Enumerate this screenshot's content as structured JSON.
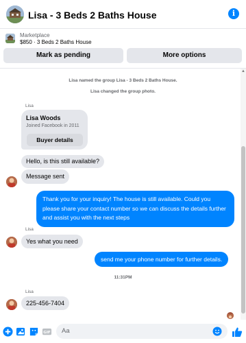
{
  "header": {
    "title": "Lisa - 3 Beds 2 Baths House",
    "info_icon": "info-icon",
    "accent": "#0084ff"
  },
  "marketplace": {
    "label": "Marketplace",
    "listing": "$850 · 3 Beds 2 Baths House",
    "pending_button": "Mark as pending",
    "more_button": "More options"
  },
  "chat": {
    "system_messages": [
      "Lisa named the group Lisa - 3 Beds 2 Baths House.",
      "Lisa changed the group photo."
    ],
    "card": {
      "sender": "Lisa",
      "name": "Lisa Woods",
      "joined": "Joined Facebook in 2011",
      "button": "Buyer details"
    },
    "incoming_1": "Hello, is this still available?",
    "incoming_2": "Message sent",
    "outgoing_1": "Thank you for your inquiry! The house is still available. Could you please share your contact number so we can discuss the details further and assist you with the next steps",
    "sender_2": "Lisa",
    "incoming_3": "Yes what you need",
    "outgoing_2": "send me your phone number for further details.",
    "timestamp": "11:31PM",
    "sender_3": "Lisa",
    "incoming_4": "225-456-7404"
  },
  "composer": {
    "placeholder": "Aa",
    "icons": [
      "add-icon",
      "image-icon",
      "sticker-icon",
      "gif-icon",
      "emoji-icon",
      "like-icon"
    ]
  }
}
